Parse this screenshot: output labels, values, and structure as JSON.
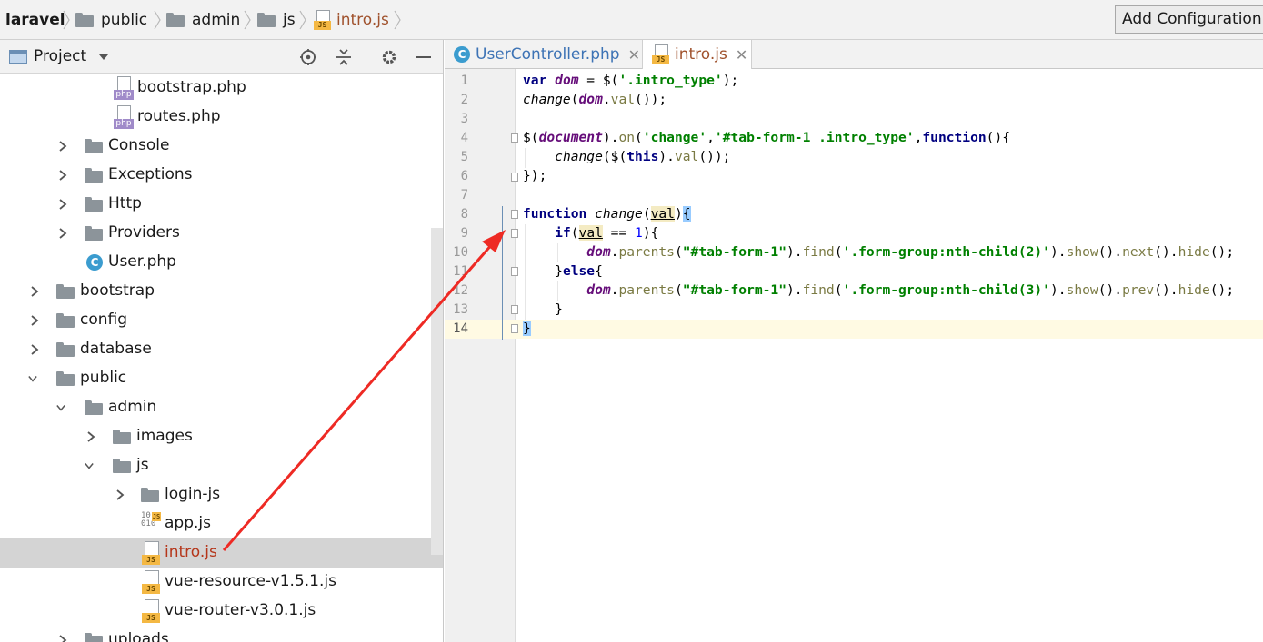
{
  "breadcrumb": {
    "items": [
      "laravel",
      "public",
      "admin",
      "js",
      "intro.js"
    ]
  },
  "toolbar": {
    "add_config_label": "Add Configuration..."
  },
  "project_panel": {
    "title": "Project",
    "tree": [
      {
        "label": "bootstrap.php",
        "type": "php"
      },
      {
        "label": "routes.php",
        "type": "php"
      },
      {
        "label": "Console",
        "type": "folder"
      },
      {
        "label": "Exceptions",
        "type": "folder"
      },
      {
        "label": "Http",
        "type": "folder"
      },
      {
        "label": "Providers",
        "type": "folder"
      },
      {
        "label": "User.php",
        "type": "class"
      },
      {
        "label": "bootstrap",
        "type": "folder"
      },
      {
        "label": "config",
        "type": "folder"
      },
      {
        "label": "database",
        "type": "folder"
      },
      {
        "label": "public",
        "type": "folder-open"
      },
      {
        "label": "admin",
        "type": "folder-open"
      },
      {
        "label": "images",
        "type": "folder"
      },
      {
        "label": "js",
        "type": "folder-open"
      },
      {
        "label": "login-js",
        "type": "folder"
      },
      {
        "label": "app.js",
        "type": "binary-js"
      },
      {
        "label": "intro.js",
        "type": "js",
        "selected": true
      },
      {
        "label": "vue-resource-v1.5.1.js",
        "type": "js"
      },
      {
        "label": "vue-router-v3.0.1.js",
        "type": "js"
      },
      {
        "label": "uploads",
        "type": "folder"
      }
    ]
  },
  "editor": {
    "tabs": [
      {
        "label": "UserController.php",
        "icon": "class-icon"
      },
      {
        "label": "intro.js",
        "icon": "js-icon",
        "active": true
      }
    ],
    "current_line": 14,
    "lines": [
      "var dom = $('.intro_type');",
      "change(dom.val());",
      "",
      "$(document).on('change','#tab-form-1 .intro_type',function(){",
      "    change($(this).val());",
      "});",
      "",
      "function change(val){",
      "    if(val == 1){",
      "        dom.parents(\"#tab-form-1\").find('.form-group:nth-child(2)').show().next().hide();",
      "    }else{",
      "        dom.parents(\"#tab-form-1\").find('.form-group:nth-child(3)').show().prev().hide();",
      "    }",
      "}"
    ]
  },
  "colors": {
    "annotation_arrow": "#ee2a24",
    "selection": "#d4d4d4",
    "current_line": "#fffae3"
  }
}
